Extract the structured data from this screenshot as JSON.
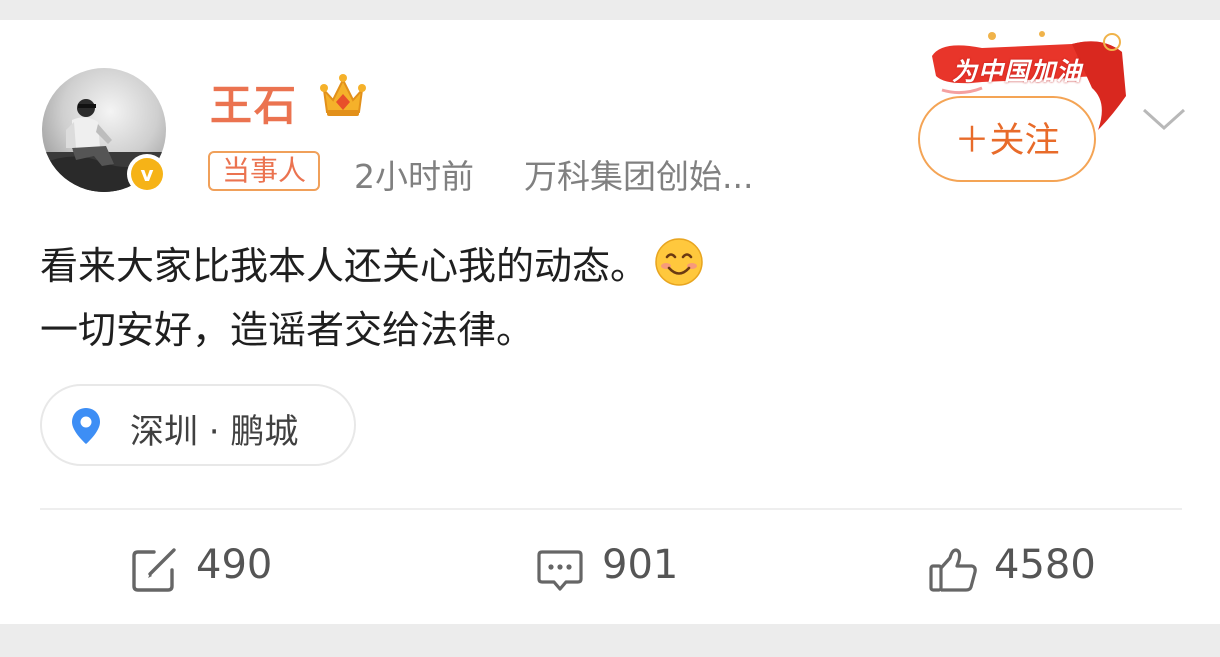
{
  "post": {
    "username": "王石",
    "tag": "当事人",
    "time": "2小时前",
    "source": "万科集团创始...",
    "content_line1": "看来大家比我本人还关心我的动态。",
    "content_line2": "一切安好，造谣者交给法律。",
    "emoji": "smiling-face-emoji",
    "location": "深圳 · 鹏城"
  },
  "header": {
    "follow_label": "＋关注",
    "promo_text": "为中国加油"
  },
  "actions": {
    "repost_count": "490",
    "comment_count": "901",
    "like_count": "4580"
  },
  "icons": {
    "crown": "crown-icon",
    "verified": "verified-v-icon",
    "more": "chevron-down-icon",
    "location": "location-pin-icon",
    "repost": "repost-icon",
    "comment": "comment-icon",
    "like": "thumbs-up-icon"
  },
  "colors": {
    "username": "#eb7350",
    "accent_orange": "#f4a455",
    "verified": "#f6b317",
    "pin": "#3d8ef5"
  }
}
